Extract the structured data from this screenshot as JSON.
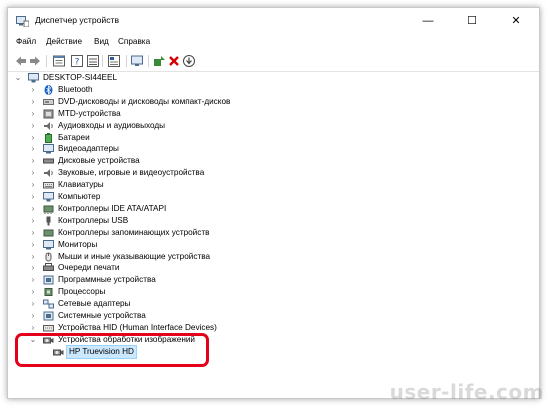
{
  "window": {
    "title": "Диспетчер устройств",
    "controls": {
      "minimize": "—",
      "maximize": "☐",
      "close": "✕"
    }
  },
  "menu": [
    "Файл",
    "Действие",
    "Вид",
    "Справка"
  ],
  "toolbar": {
    "icons": [
      "back-arrow-icon",
      "forward-arrow-icon",
      "properties-icon",
      "help-icon",
      "view-icon",
      "scan-icon",
      "monitor-icon",
      "update-driver-icon",
      "remove-device-icon",
      "download-icon"
    ]
  },
  "tree": {
    "root": "DESKTOP-SI44EEL",
    "categories": [
      "Bluetooth",
      "DVD-дисководы и дисководы компакт-дисков",
      "MTD-устройства",
      "Аудиовходы и аудиовыходы",
      "Батареи",
      "Видеоадаптеры",
      "Дисковые устройства",
      "Звуковые, игровые и видеоустройства",
      "Клавиатуры",
      "Компьютер",
      "Контроллеры IDE ATA/ATAPI",
      "Контроллеры USB",
      "Контроллеры запоминающих устройств",
      "Мониторы",
      "Мыши и иные указывающие устройства",
      "Очереди печати",
      "Программные устройства",
      "Процессоры",
      "Сетевые адаптеры",
      "Системные устройства",
      "Устройства HID (Human Interface Devices)",
      "Устройства обработки изображений"
    ],
    "expanded_child": "HP Truevision HD"
  },
  "colors": {
    "highlight": "#e4001b",
    "selection": "#cce8ff",
    "accent": "#0078d7"
  },
  "watermark": "user-life.com"
}
